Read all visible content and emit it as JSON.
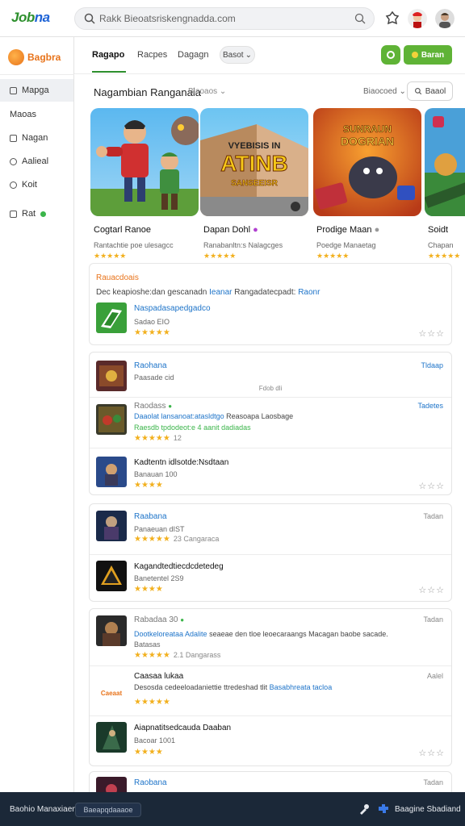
{
  "app": {
    "logo_text_1": "Job",
    "logo_text_2": "na"
  },
  "search": {
    "value": "Rakk Bieoatsriskengnadda.com"
  },
  "sidebar": {
    "brand": "Bagbra",
    "items": [
      {
        "label": "Mapga"
      },
      {
        "label": "Maoas"
      },
      {
        "label": "Nagan"
      },
      {
        "label": "Aalieal"
      },
      {
        "label": "Koit"
      },
      {
        "label": "Rat"
      }
    ]
  },
  "tabs": [
    {
      "label": "Ragapo"
    },
    {
      "label": "Racpes"
    },
    {
      "label": "Dagagn"
    }
  ],
  "filter_pill": "Basot",
  "header_button": "Baran",
  "section": {
    "title": "Nagambian Ranganaia",
    "filter": "Biaoaos",
    "sort": "Biaocoed",
    "search_button": "Baaol"
  },
  "featured": [
    {
      "title": "Cogtarl Ranoe",
      "sub": "Rantachtie poe ulesagcc",
      "stars": "★★★★★",
      "image_text": ""
    },
    {
      "title": "Dapan Dohl",
      "sub": "Ranabanltn:s Nalagcges",
      "stars": "★★★★★",
      "image_text": "VYEBISIS IN ATINB SANSEEISR"
    },
    {
      "title": "Prodige Maan",
      "sub": "Poedge Manaetag",
      "stars": "★★★★★",
      "image_text": "SUNRAUN DOGRIAN BEACEO"
    },
    {
      "title": "Soidt",
      "sub": "Chapan",
      "stars": "★★★★★",
      "image_text": ""
    }
  ],
  "promo": {
    "label": "Rauacdoais",
    "text": "Dec keapioshe:dan gescanadn",
    "text_link": "Ieanar",
    "text_end": "Rangadatecpadt:",
    "text_link2": "Raonr",
    "game": {
      "title": "Naspadasapedgadco",
      "sub": "Sadao EIO",
      "stars": "★★★★★"
    }
  },
  "list1": [
    {
      "title": "Raohana",
      "sub": "Paasade cid",
      "right": "Tldaap",
      "note": "Fdob dli"
    },
    {
      "title": "Raodass",
      "desc": "Daaolat lansanoat:atasldtgo",
      "desc_link": "Reasoapa Laosbage",
      "desc_mid": "Raesdb tpdodeot:e 4 aanit dadiadas",
      "stars": "★★★★★",
      "meta": "12",
      "right": "Tadetes"
    },
    {
      "title": "Kadtentn idlsotde:Nsdtaan",
      "sub": "Banauan 100",
      "stars": "★★★★"
    }
  ],
  "list2": [
    {
      "title": "Raabana",
      "sub": "Panaeuan dIST",
      "stars": "★★★★★",
      "meta": "23  Cangaraca",
      "right": "Tadan"
    },
    {
      "title": "Kagandtedtiecdcdetedeg",
      "sub": "Banetentel 2S9",
      "stars": "★★★★"
    }
  ],
  "list3": [
    {
      "title": "Rabadaa 30",
      "desc_link": "Dootkeloreataa Adalite",
      "desc": "seaeae den tloe leoecaraangs Macagan baobe sacade.",
      "sub": "Batasas",
      "stars": "★★★★★",
      "meta": "2.1  Dangarass",
      "right": "Tadan"
    },
    {
      "title": "Caasaa lukaa",
      "logo_text": "Caeaat",
      "desc": "Desosda cedeeloadaniettie ttredeshad tlit",
      "desc_link": "Basabhreata tacloa",
      "stars": "★★★★★",
      "right": "Aalel"
    },
    {
      "title": "Aiapnatitsedcauda Daaban",
      "sub": "Bacoar 1001",
      "stars": "★★★★"
    }
  ],
  "list4": [
    {
      "title": "Raobana",
      "right": "Tadan"
    }
  ],
  "bottom": {
    "left": "Baohio Manaxiaen",
    "pill": "Baeapqdaaaoe",
    "right": "Baagine Sbadiand"
  }
}
